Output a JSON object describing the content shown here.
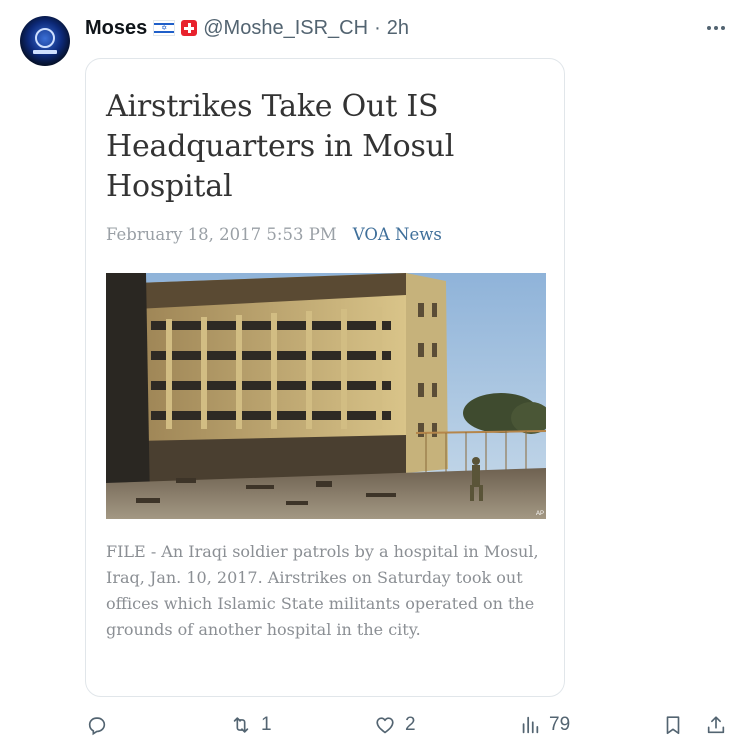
{
  "user": {
    "name": "Moses",
    "handle": "@Moshe_ISR_CH",
    "separator": "·",
    "time": "2h"
  },
  "article": {
    "headline": "Airstrikes Take Out IS Headquarters in Mosul Hospital",
    "date": "February 18, 2017 5:53 PM",
    "source": "VOA News",
    "photo_credit": "AP",
    "caption": "FILE - An Iraqi soldier patrols by a hospital in Mosul, Iraq, Jan. 10, 2017. Airstrikes on Saturday took out offices which Islamic State militants operated on the grounds of another hospital in the city."
  },
  "actions": {
    "reply_count": "",
    "retweet_count": "1",
    "like_count": "2",
    "views_count": "79"
  },
  "icons": [
    "avatar",
    "israel-flag-icon",
    "swiss-flag-icon",
    "more-icon",
    "reply-icon",
    "retweet-icon",
    "like-icon",
    "views-icon",
    "bookmark-icon",
    "share-icon"
  ],
  "colors": {
    "text_primary": "#0f1419",
    "text_secondary": "#536471",
    "source_link": "#3f6f9a",
    "date": "#9aa0a6",
    "caption": "#8b8f94"
  }
}
